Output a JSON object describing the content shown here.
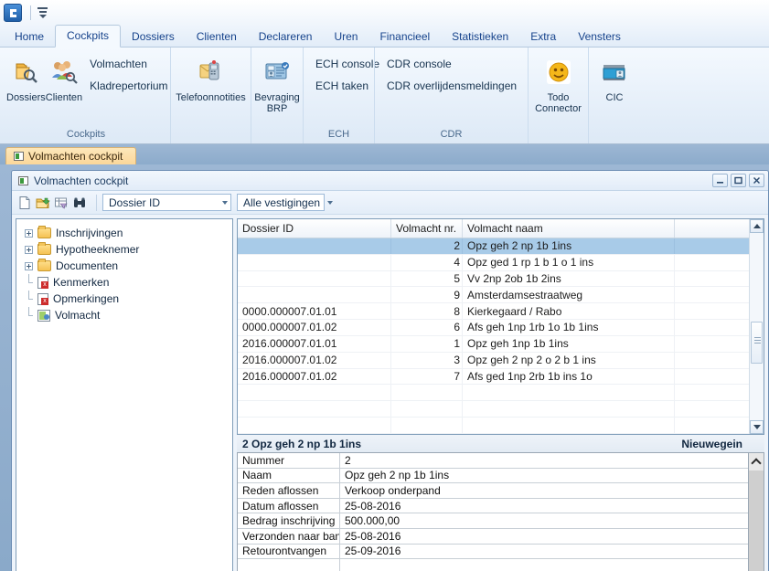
{
  "quick_access": {
    "logo_icon": "app-logo-icon",
    "dropdown_icon": "customize-qat-icon"
  },
  "ribbon": {
    "tabs": [
      {
        "label": "Home",
        "active": false
      },
      {
        "label": "Cockpits",
        "active": true
      },
      {
        "label": "Dossiers",
        "active": false
      },
      {
        "label": "Clienten",
        "active": false
      },
      {
        "label": "Declareren",
        "active": false
      },
      {
        "label": "Uren",
        "active": false
      },
      {
        "label": "Financieel",
        "active": false
      },
      {
        "label": "Statistieken",
        "active": false
      },
      {
        "label": "Extra",
        "active": false
      },
      {
        "label": "Vensters",
        "active": false
      }
    ],
    "groups": [
      {
        "name": "Cockpits",
        "big_buttons": [
          {
            "label": "Dossiers",
            "icon": "folder-search-icon"
          },
          {
            "label": "Clienten",
            "icon": "people-search-icon"
          }
        ],
        "links": [
          "Volmachten",
          "Kladrepertorium"
        ]
      },
      {
        "name": "",
        "big_buttons": [
          {
            "label": "Telefoonnotities",
            "icon": "phone-note-icon"
          }
        ],
        "links": []
      },
      {
        "name": "",
        "big_buttons": [
          {
            "label": "Bevraging BRP",
            "icon": "id-card-icon"
          }
        ],
        "links": []
      },
      {
        "name": "ECH",
        "big_buttons": [],
        "links": [
          "ECH console",
          "ECH taken"
        ]
      },
      {
        "name": "CDR",
        "big_buttons": [],
        "links": [
          "CDR console",
          "CDR overlijdensmeldingen"
        ]
      },
      {
        "name": "",
        "big_buttons": [
          {
            "label": "Todo Connector",
            "icon": "smiley-icon"
          }
        ],
        "links": []
      },
      {
        "name": "",
        "big_buttons": [
          {
            "label": "CIC",
            "icon": "cic-icon"
          }
        ],
        "links": []
      }
    ]
  },
  "mdi_tabs": [
    {
      "label": "Volmachten cockpit",
      "icon": "window-icon",
      "active": true
    }
  ],
  "child_window": {
    "title": "Volmachten cockpit",
    "title_icon": "window-icon",
    "buttons": {
      "minimize": "—",
      "maximize": "□",
      "close": "✕"
    },
    "toolbar": {
      "icons": [
        {
          "name": "new-document-icon"
        },
        {
          "name": "open-folder-icon"
        },
        {
          "name": "grid-filter-icon"
        },
        {
          "name": "binoculars-find-icon"
        }
      ],
      "combo_sort": {
        "value": "Dossier ID",
        "placeholder": "Dossier ID"
      },
      "combo_branch": {
        "value": "Alle vestigingen",
        "placeholder": "Alle vestigingen"
      }
    }
  },
  "tree": {
    "items": [
      {
        "label": "Inschrijvingen",
        "icon": "folder-icon",
        "expandable": true
      },
      {
        "label": "Hypotheeknemer",
        "icon": "folder-icon",
        "expandable": true
      },
      {
        "label": "Documenten",
        "icon": "folder-icon",
        "expandable": true
      },
      {
        "label": "Kenmerken",
        "icon": "x-document-icon",
        "expandable": false
      },
      {
        "label": "Opmerkingen",
        "icon": "x-document-icon",
        "expandable": false
      },
      {
        "label": "Volmacht",
        "icon": "volmacht-icon",
        "expandable": false
      }
    ]
  },
  "grid": {
    "columns": [
      "Dossier ID",
      "Volmacht nr.",
      "Volmacht naam",
      ""
    ],
    "rows": [
      {
        "dossier_id": "",
        "nr": "2",
        "naam": "Opz geh 2 np 1b 1ins",
        "extra": "",
        "selected": true
      },
      {
        "dossier_id": "",
        "nr": "4",
        "naam": "Opz ged 1 rp 1 b 1 o 1 ins",
        "extra": "",
        "selected": false
      },
      {
        "dossier_id": "",
        "nr": "5",
        "naam": "Vv 2np 2ob 1b 2ins",
        "extra": "",
        "selected": false
      },
      {
        "dossier_id": "",
        "nr": "9",
        "naam": "Amsterdamsestraatweg",
        "extra": "",
        "selected": false
      },
      {
        "dossier_id": "0000.000007.01.01",
        "nr": "8",
        "naam": "Kierkegaard / Rabo",
        "extra": "",
        "selected": false
      },
      {
        "dossier_id": "0000.000007.01.02",
        "nr": "6",
        "naam": "Afs geh 1np 1rb 1o 1b 1ins",
        "extra": "",
        "selected": false
      },
      {
        "dossier_id": "2016.000007.01.01",
        "nr": "1",
        "naam": "Opz geh 1np 1b 1ins",
        "extra": "",
        "selected": false
      },
      {
        "dossier_id": "2016.000007.01.02",
        "nr": "3",
        "naam": "Opz geh 2 np 2 o 2 b 1 ins",
        "extra": "",
        "selected": false
      },
      {
        "dossier_id": "2016.000007.01.02",
        "nr": "7",
        "naam": "Afs ged 1np 2rb 1b  ins 1o",
        "extra": "",
        "selected": false
      },
      {
        "dossier_id": "",
        "nr": "",
        "naam": "",
        "extra": "",
        "selected": false
      },
      {
        "dossier_id": "",
        "nr": "",
        "naam": "",
        "extra": "",
        "selected": false
      },
      {
        "dossier_id": "",
        "nr": "",
        "naam": "",
        "extra": "",
        "selected": false
      }
    ],
    "scrollbar": {
      "up_icon": "scroll-up-icon",
      "down_icon": "scroll-down-icon"
    }
  },
  "detail": {
    "header_left": "2 Opz geh 2 np 1b 1ins",
    "header_right": "Nieuwegein",
    "fields": [
      {
        "label": "Nummer",
        "value": "2"
      },
      {
        "label": "Naam",
        "value": "Opz geh 2 np 1b 1ins"
      },
      {
        "label": "Reden aflossen",
        "value": "Verkoop onderpand"
      },
      {
        "label": "Datum aflossen",
        "value": "25-08-2016"
      },
      {
        "label": "Bedrag inschrijving",
        "value": "500.000,00"
      },
      {
        "label": "Verzonden naar bank",
        "value": "25-08-2016"
      },
      {
        "label": "Retourontvangen",
        "value": "25-09-2016"
      }
    ],
    "scroll_up_icon": "chevron-up-icon"
  },
  "colors": {
    "accent": "#15428b",
    "selection": "#a8cbe8",
    "tab_active": "#fbd79a",
    "mdi_background": "#9db7d4"
  }
}
